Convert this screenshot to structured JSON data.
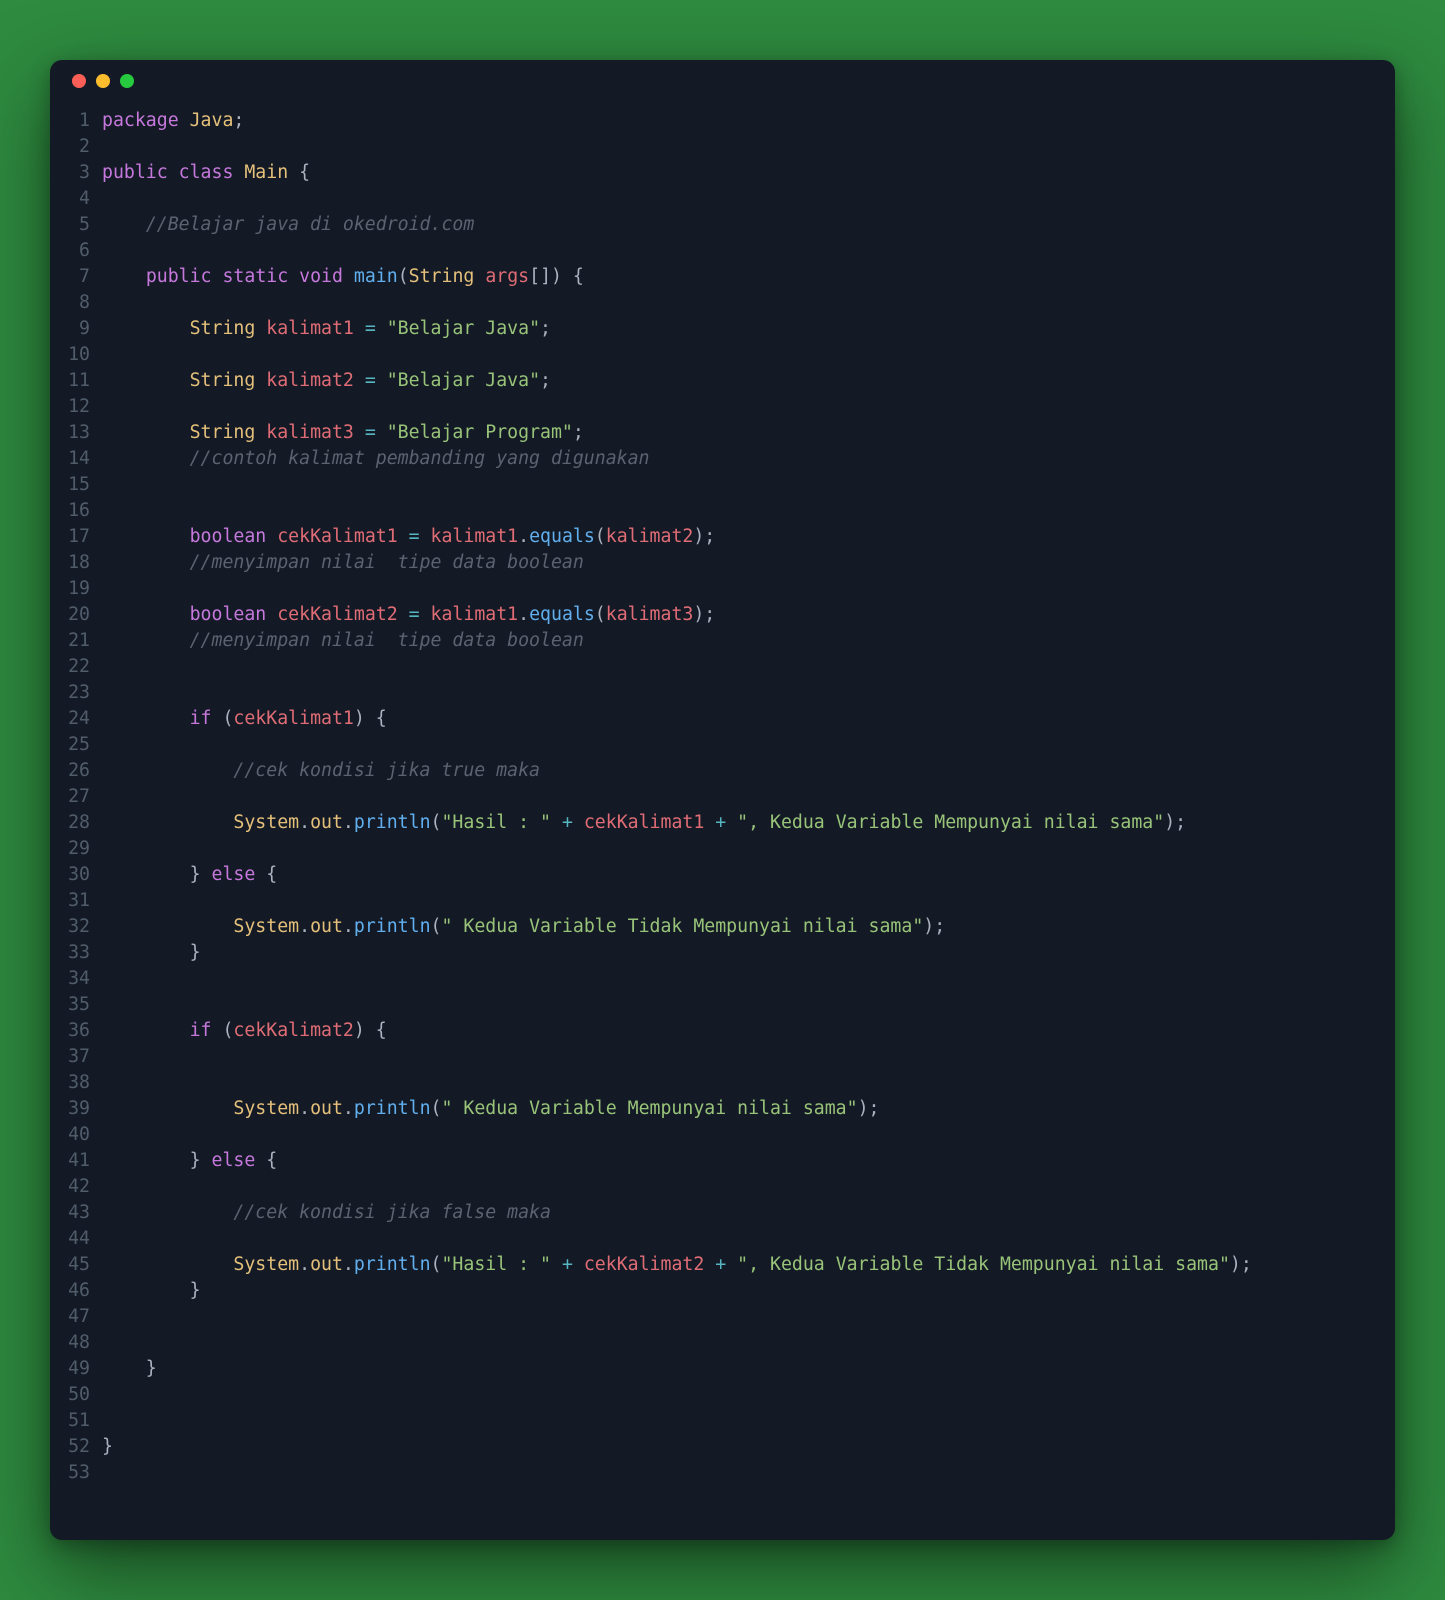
{
  "window": {
    "controls": [
      "close",
      "minimize",
      "zoom"
    ]
  },
  "code": {
    "lines": [
      [
        {
          "c": "kw",
          "t": "package"
        },
        {
          "c": "pun",
          "t": " "
        },
        {
          "c": "cls",
          "t": "Java"
        },
        {
          "c": "pun",
          "t": ";"
        }
      ],
      [],
      [
        {
          "c": "kw",
          "t": "public"
        },
        {
          "c": "pun",
          "t": " "
        },
        {
          "c": "kw",
          "t": "class"
        },
        {
          "c": "pun",
          "t": " "
        },
        {
          "c": "cls",
          "t": "Main"
        },
        {
          "c": "pun",
          "t": " {"
        }
      ],
      [],
      [
        {
          "c": "pun",
          "t": "    "
        },
        {
          "c": "cmt",
          "t": "//Belajar java di okedroid.com"
        }
      ],
      [],
      [
        {
          "c": "pun",
          "t": "    "
        },
        {
          "c": "kw",
          "t": "public"
        },
        {
          "c": "pun",
          "t": " "
        },
        {
          "c": "kw",
          "t": "static"
        },
        {
          "c": "pun",
          "t": " "
        },
        {
          "c": "kw",
          "t": "void"
        },
        {
          "c": "pun",
          "t": " "
        },
        {
          "c": "fn",
          "t": "main"
        },
        {
          "c": "pun",
          "t": "("
        },
        {
          "c": "cls",
          "t": "String"
        },
        {
          "c": "pun",
          "t": " "
        },
        {
          "c": "var",
          "t": "args"
        },
        {
          "c": "pun",
          "t": "[]) {"
        }
      ],
      [],
      [
        {
          "c": "pun",
          "t": "        "
        },
        {
          "c": "cls",
          "t": "String"
        },
        {
          "c": "pun",
          "t": " "
        },
        {
          "c": "var",
          "t": "kalimat1"
        },
        {
          "c": "pun",
          "t": " "
        },
        {
          "c": "op",
          "t": "="
        },
        {
          "c": "pun",
          "t": " "
        },
        {
          "c": "str",
          "t": "\"Belajar Java\""
        },
        {
          "c": "pun",
          "t": ";"
        }
      ],
      [],
      [
        {
          "c": "pun",
          "t": "        "
        },
        {
          "c": "cls",
          "t": "String"
        },
        {
          "c": "pun",
          "t": " "
        },
        {
          "c": "var",
          "t": "kalimat2"
        },
        {
          "c": "pun",
          "t": " "
        },
        {
          "c": "op",
          "t": "="
        },
        {
          "c": "pun",
          "t": " "
        },
        {
          "c": "str",
          "t": "\"Belajar Java\""
        },
        {
          "c": "pun",
          "t": ";"
        }
      ],
      [],
      [
        {
          "c": "pun",
          "t": "        "
        },
        {
          "c": "cls",
          "t": "String"
        },
        {
          "c": "pun",
          "t": " "
        },
        {
          "c": "var",
          "t": "kalimat3"
        },
        {
          "c": "pun",
          "t": " "
        },
        {
          "c": "op",
          "t": "="
        },
        {
          "c": "pun",
          "t": " "
        },
        {
          "c": "str",
          "t": "\"Belajar Program\""
        },
        {
          "c": "pun",
          "t": ";"
        }
      ],
      [
        {
          "c": "pun",
          "t": "        "
        },
        {
          "c": "cmt",
          "t": "//contoh kalimat pembanding yang digunakan"
        }
      ],
      [],
      [],
      [
        {
          "c": "pun",
          "t": "        "
        },
        {
          "c": "kw",
          "t": "boolean"
        },
        {
          "c": "pun",
          "t": " "
        },
        {
          "c": "var",
          "t": "cekKalimat1"
        },
        {
          "c": "pun",
          "t": " "
        },
        {
          "c": "op",
          "t": "="
        },
        {
          "c": "pun",
          "t": " "
        },
        {
          "c": "var",
          "t": "kalimat1"
        },
        {
          "c": "pun",
          "t": "."
        },
        {
          "c": "fn",
          "t": "equals"
        },
        {
          "c": "pun",
          "t": "("
        },
        {
          "c": "var",
          "t": "kalimat2"
        },
        {
          "c": "pun",
          "t": ");"
        }
      ],
      [
        {
          "c": "pun",
          "t": "        "
        },
        {
          "c": "cmt",
          "t": "//menyimpan nilai  tipe data boolean"
        }
      ],
      [],
      [
        {
          "c": "pun",
          "t": "        "
        },
        {
          "c": "kw",
          "t": "boolean"
        },
        {
          "c": "pun",
          "t": " "
        },
        {
          "c": "var",
          "t": "cekKalimat2"
        },
        {
          "c": "pun",
          "t": " "
        },
        {
          "c": "op",
          "t": "="
        },
        {
          "c": "pun",
          "t": " "
        },
        {
          "c": "var",
          "t": "kalimat1"
        },
        {
          "c": "pun",
          "t": "."
        },
        {
          "c": "fn",
          "t": "equals"
        },
        {
          "c": "pun",
          "t": "("
        },
        {
          "c": "var",
          "t": "kalimat3"
        },
        {
          "c": "pun",
          "t": ");"
        }
      ],
      [
        {
          "c": "pun",
          "t": "        "
        },
        {
          "c": "cmt",
          "t": "//menyimpan nilai  tipe data boolean"
        }
      ],
      [],
      [],
      [
        {
          "c": "pun",
          "t": "        "
        },
        {
          "c": "kw",
          "t": "if"
        },
        {
          "c": "pun",
          "t": " ("
        },
        {
          "c": "var",
          "t": "cekKalimat1"
        },
        {
          "c": "pun",
          "t": ") {"
        }
      ],
      [],
      [
        {
          "c": "pun",
          "t": "            "
        },
        {
          "c": "cmt",
          "t": "//cek kondisi jika true maka"
        }
      ],
      [],
      [
        {
          "c": "pun",
          "t": "            "
        },
        {
          "c": "cls",
          "t": "System"
        },
        {
          "c": "pun",
          "t": "."
        },
        {
          "c": "prop",
          "t": "out"
        },
        {
          "c": "pun",
          "t": "."
        },
        {
          "c": "fn",
          "t": "println"
        },
        {
          "c": "pun",
          "t": "("
        },
        {
          "c": "str",
          "t": "\"Hasil : \""
        },
        {
          "c": "pun",
          "t": " "
        },
        {
          "c": "op",
          "t": "+"
        },
        {
          "c": "pun",
          "t": " "
        },
        {
          "c": "var",
          "t": "cekKalimat1"
        },
        {
          "c": "pun",
          "t": " "
        },
        {
          "c": "op",
          "t": "+"
        },
        {
          "c": "pun",
          "t": " "
        },
        {
          "c": "str",
          "t": "\", Kedua Variable Mempunyai nilai sama\""
        },
        {
          "c": "pun",
          "t": ");"
        }
      ],
      [],
      [
        {
          "c": "pun",
          "t": "        } "
        },
        {
          "c": "kw",
          "t": "else"
        },
        {
          "c": "pun",
          "t": " {"
        }
      ],
      [],
      [
        {
          "c": "pun",
          "t": "            "
        },
        {
          "c": "cls",
          "t": "System"
        },
        {
          "c": "pun",
          "t": "."
        },
        {
          "c": "prop",
          "t": "out"
        },
        {
          "c": "pun",
          "t": "."
        },
        {
          "c": "fn",
          "t": "println"
        },
        {
          "c": "pun",
          "t": "("
        },
        {
          "c": "str",
          "t": "\" Kedua Variable Tidak Mempunyai nilai sama\""
        },
        {
          "c": "pun",
          "t": ");"
        }
      ],
      [
        {
          "c": "pun",
          "t": "        }"
        }
      ],
      [],
      [],
      [
        {
          "c": "pun",
          "t": "        "
        },
        {
          "c": "kw",
          "t": "if"
        },
        {
          "c": "pun",
          "t": " ("
        },
        {
          "c": "var",
          "t": "cekKalimat2"
        },
        {
          "c": "pun",
          "t": ") {"
        }
      ],
      [],
      [],
      [
        {
          "c": "pun",
          "t": "            "
        },
        {
          "c": "cls",
          "t": "System"
        },
        {
          "c": "pun",
          "t": "."
        },
        {
          "c": "prop",
          "t": "out"
        },
        {
          "c": "pun",
          "t": "."
        },
        {
          "c": "fn",
          "t": "println"
        },
        {
          "c": "pun",
          "t": "("
        },
        {
          "c": "str",
          "t": "\" Kedua Variable Mempunyai nilai sama\""
        },
        {
          "c": "pun",
          "t": ");"
        }
      ],
      [],
      [
        {
          "c": "pun",
          "t": "        } "
        },
        {
          "c": "kw",
          "t": "else"
        },
        {
          "c": "pun",
          "t": " {"
        }
      ],
      [],
      [
        {
          "c": "pun",
          "t": "            "
        },
        {
          "c": "cmt",
          "t": "//cek kondisi jika false maka"
        }
      ],
      [],
      [
        {
          "c": "pun",
          "t": "            "
        },
        {
          "c": "cls",
          "t": "System"
        },
        {
          "c": "pun",
          "t": "."
        },
        {
          "c": "prop",
          "t": "out"
        },
        {
          "c": "pun",
          "t": "."
        },
        {
          "c": "fn",
          "t": "println"
        },
        {
          "c": "pun",
          "t": "("
        },
        {
          "c": "str",
          "t": "\"Hasil : \""
        },
        {
          "c": "pun",
          "t": " "
        },
        {
          "c": "op",
          "t": "+"
        },
        {
          "c": "pun",
          "t": " "
        },
        {
          "c": "var",
          "t": "cekKalimat2"
        },
        {
          "c": "pun",
          "t": " "
        },
        {
          "c": "op",
          "t": "+"
        },
        {
          "c": "pun",
          "t": " "
        },
        {
          "c": "str",
          "t": "\", Kedua Variable Tidak Mempunyai nilai sama\""
        },
        {
          "c": "pun",
          "t": ");"
        }
      ],
      [
        {
          "c": "pun",
          "t": "        }"
        }
      ],
      [],
      [],
      [
        {
          "c": "pun",
          "t": "    }"
        }
      ],
      [],
      [],
      [
        {
          "c": "pun",
          "t": "}"
        }
      ],
      []
    ]
  }
}
